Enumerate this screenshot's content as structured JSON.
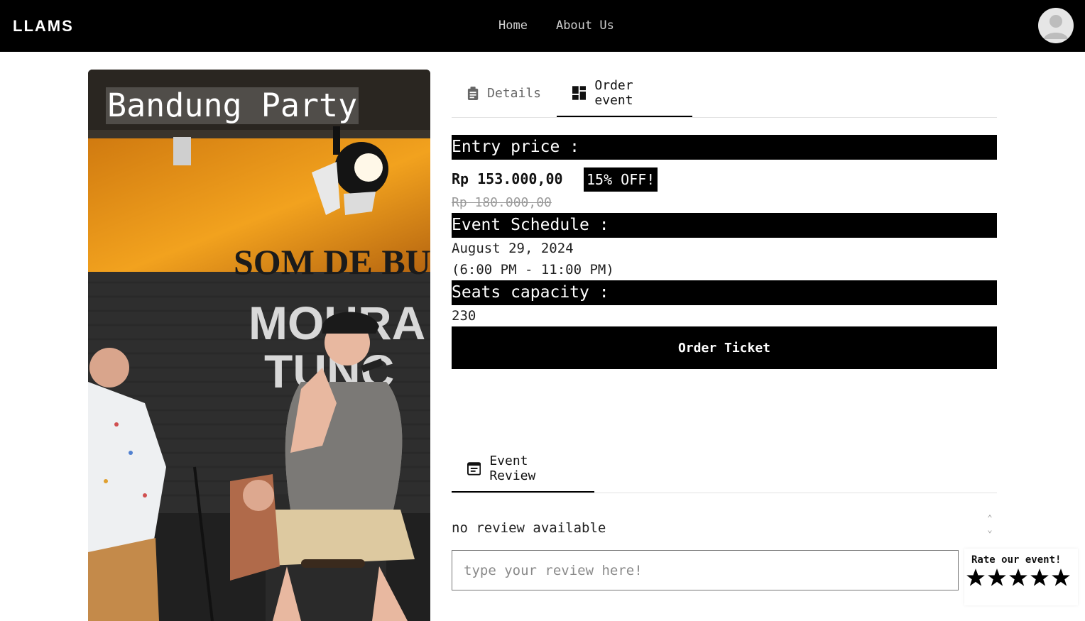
{
  "navbar": {
    "logo_text": "LLAMS",
    "links": [
      {
        "label": "Home"
      },
      {
        "label": "About Us"
      }
    ]
  },
  "event": {
    "title": "Bandung Party",
    "poster_text": [
      "SOM DE BU",
      "MOURA",
      "TUNC"
    ]
  },
  "tabs": [
    {
      "label": "Details",
      "icon": "clipboard-icon",
      "active": false
    },
    {
      "label": "Order event",
      "icon": "dashboard-icon",
      "active": true
    }
  ],
  "order": {
    "entry_label": "Entry price :",
    "price": "Rp 153.000,00",
    "discount": "15% OFF!",
    "original_price": "Rp 180.000,00",
    "schedule_label": "Event Schedule :",
    "date": "August 29, 2024",
    "time": "(6:00 PM - 11:00 PM)",
    "seats_label": "Seats capacity :",
    "seats": "230",
    "button_label": "Order Ticket"
  },
  "review": {
    "tab_label": "Event Review",
    "tab_icon": "calendar-icon",
    "empty_text": "no review available",
    "input_placeholder": "type your review here!",
    "input_value": "",
    "rate_label": "Rate our event!",
    "stars_max": 5,
    "rating": 0
  },
  "colors": {
    "navbar_bg": "#000000",
    "accent": "#000000",
    "muted_text": "#9a9a9a"
  }
}
